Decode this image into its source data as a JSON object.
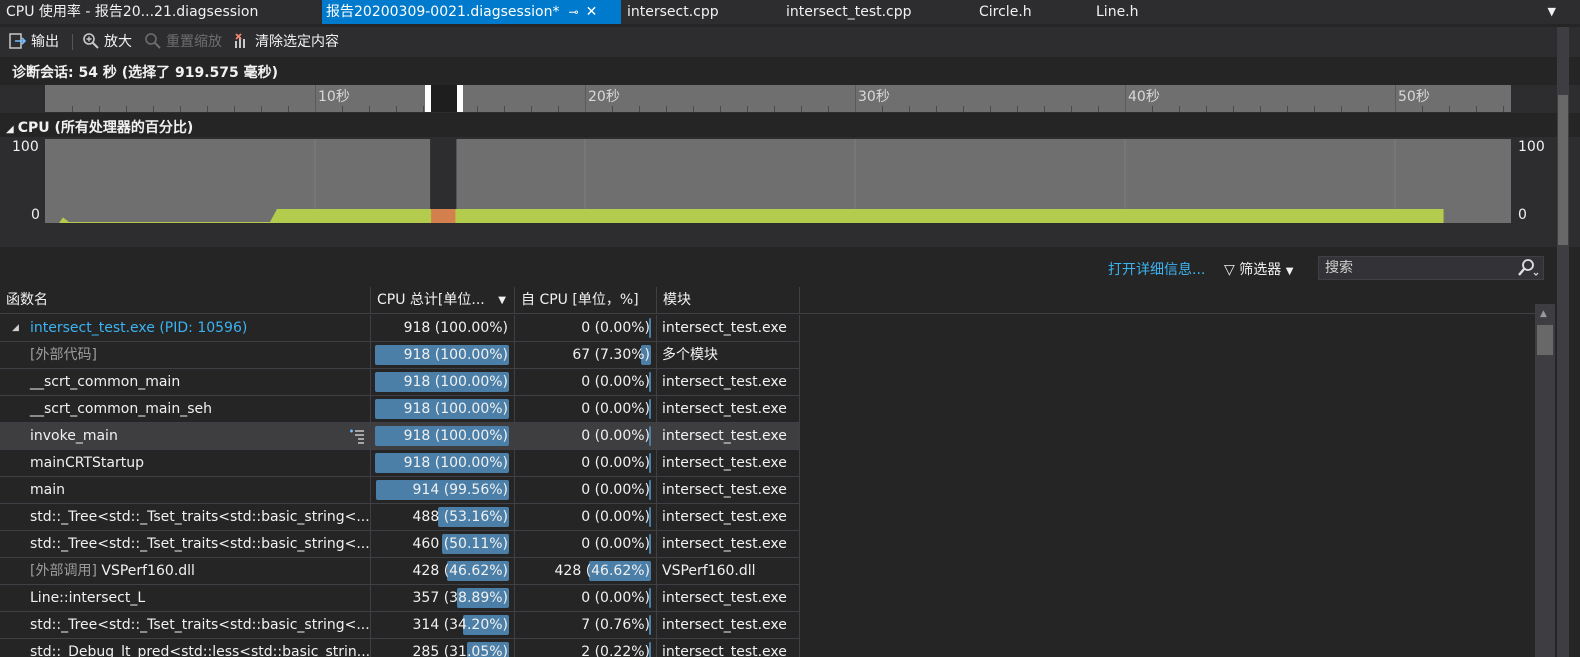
{
  "tabs": [
    {
      "label": "CPU 使用率 - 报告20...21.diagsession",
      "active": false
    },
    {
      "label": "报告20200309-0021.diagsession*",
      "active": true
    },
    {
      "label": "intersect.cpp",
      "active": false
    },
    {
      "label": "intersect_test.cpp",
      "active": false
    },
    {
      "label": "Circle.h",
      "active": false
    },
    {
      "label": "Line.h",
      "active": false
    }
  ],
  "toolbar": {
    "export_label": "输出",
    "zoom_in_label": "放大",
    "reset_zoom_label": "重置缩放",
    "clear_selection_label": "清除选定内容"
  },
  "session": {
    "text": "诊断会话: 54 秒 (选择了 919.575 毫秒)"
  },
  "ruler": {
    "labels": [
      "10秒",
      "20秒",
      "30秒",
      "40秒",
      "50秒"
    ]
  },
  "cpu_graph": {
    "title": "CPU (所有处理器的百分比)",
    "y_max_label": "100",
    "y_min_label": "0",
    "session_seconds": 54,
    "selection_seconds": [
      14.3,
      15.2
    ],
    "usage_percent_steady": 12.5,
    "usage_percent_start": 2,
    "colors": {
      "fill": "#b4cc4e",
      "selection_fill": "#d4804e",
      "bg": "#6f6f6f"
    }
  },
  "detail_bar": {
    "open_details_label": "打开详细信息...",
    "filter_label": "筛选器",
    "search_placeholder": "搜索"
  },
  "table": {
    "columns": [
      {
        "label": "函数名"
      },
      {
        "label": "CPU 总计[单位..."
      },
      {
        "label": "自 CPU [单位，%]"
      },
      {
        "label": "模块"
      }
    ],
    "rows": [
      {
        "name": "intersect_test.exe (PID: 10596)",
        "total": "918 (100.00%)",
        "total_pct": 0,
        "self": "0 (0.00%)",
        "self_pct": 0,
        "module": "intersect_test.exe",
        "root": true
      },
      {
        "name": "[外部代码]",
        "total": "918 (100.00%)",
        "total_pct": 100,
        "self": "67 (7.30%)",
        "self_pct": 7.3,
        "module": "多个模块",
        "grey": true
      },
      {
        "name": "__scrt_common_main",
        "total": "918 (100.00%)",
        "total_pct": 100,
        "self": "0 (0.00%)",
        "self_pct": 0,
        "module": "intersect_test.exe"
      },
      {
        "name": "__scrt_common_main_seh",
        "total": "918 (100.00%)",
        "total_pct": 100,
        "self": "0 (0.00%)",
        "self_pct": 0,
        "module": "intersect_test.exe"
      },
      {
        "name": "invoke_main",
        "total": "918 (100.00%)",
        "total_pct": 100,
        "self": "0 (0.00%)",
        "self_pct": 0,
        "module": "intersect_test.exe",
        "hover": true
      },
      {
        "name": "mainCRTStartup",
        "total": "918 (100.00%)",
        "total_pct": 100,
        "self": "0 (0.00%)",
        "self_pct": 0,
        "module": "intersect_test.exe"
      },
      {
        "name": "main",
        "total": "914 (99.56%)",
        "total_pct": 99.56,
        "self": "0 (0.00%)",
        "self_pct": 0,
        "module": "intersect_test.exe"
      },
      {
        "name": "std::_Tree<std::_Tset_traits<std::basic_string<...",
        "total": "488 (53.16%)",
        "total_pct": 53.16,
        "self": "0 (0.00%)",
        "self_pct": 0,
        "module": "intersect_test.exe"
      },
      {
        "name": "std::_Tree<std::_Tset_traits<std::basic_string<...",
        "total": "460 (50.11%)",
        "total_pct": 50.11,
        "self": "0 (0.00%)",
        "self_pct": 0,
        "module": "intersect_test.exe"
      },
      {
        "name_prefix": "[外部调用]",
        "name": "VSPerf160.dll",
        "total": "428 (46.62%)",
        "total_pct": 46.62,
        "self": "428 (46.62%)",
        "self_pct": 46.62,
        "module": "VSPerf160.dll"
      },
      {
        "name": "Line::intersect_L",
        "total": "357 (38.89%)",
        "total_pct": 38.89,
        "self": "0 (0.00%)",
        "self_pct": 0,
        "module": "intersect_test.exe"
      },
      {
        "name": "std::_Tree<std::_Tset_traits<std::basic_string<...",
        "total": "314 (34.20%)",
        "total_pct": 34.2,
        "self": "7 (0.76%)",
        "self_pct": 0.76,
        "module": "intersect_test.exe"
      },
      {
        "name": "std::_Debug_lt_pred<std::less<std::basic_strin...",
        "total": "285 (31.05%)",
        "total_pct": 31.05,
        "self": "2 (0.22%)",
        "self_pct": 0.22,
        "module": "intersect_test.exe"
      }
    ]
  },
  "colors": {
    "accent": "#007acc",
    "link": "#3bb3f0",
    "bar": "#4b7fa8"
  }
}
